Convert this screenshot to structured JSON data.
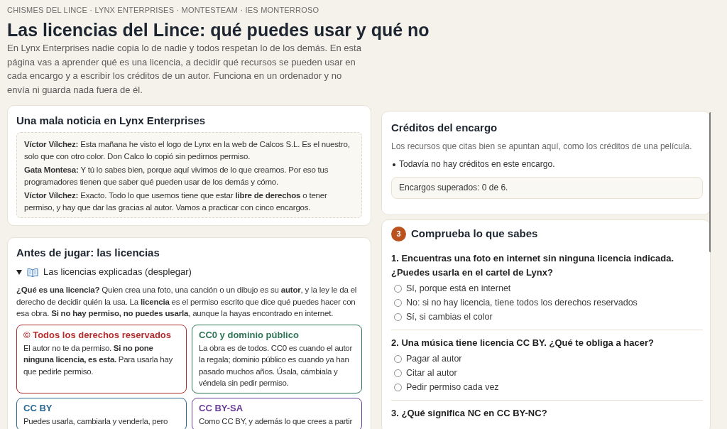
{
  "breadcrumb": "CHISMES DEL LINCE · LYNX ENTERPRISES · MONTESTEAM · IES MONTERROSO",
  "title": "Las licencias del Lince: qué puedes usar y qué no",
  "intro": "En Lynx Enterprises nadie copia lo de nadie y todos respetan lo de los demás. En esta página vas a aprender qué es una licencia, a decidir qué recursos se pueden usar en cada encargo y a escribir los créditos de un autor. Funciona en un ordenador y no envía ni guarda nada fuera de él.",
  "story": {
    "title": "Una mala noticia en Lynx Enterprises",
    "lines": [
      "**Víctor Vílchez:** Esta mañana he visto el logo de Lynx en la web de Calcos S.L. Es el nuestro, solo que con otro color. Don Calco lo copió sin pedirnos permiso.",
      "**Gata Montesa:** Y tú lo sabes bien, porque aquí vivimos de lo que creamos. Por eso tus programadores tienen que saber qué pueden usar de los demás y cómo.",
      "**Víctor Vílchez:** Exacto. Todo lo que usemos tiene que estar **libre de derechos** o tener permiso, y hay que dar las gracias al autor. Vamos a practicar con cinco encargos."
    ]
  },
  "licenses": {
    "title": "Antes de jugar: las licencias",
    "details": {
      "label": "Las licencias explicadas (desplegar)",
      "expanded": true
    },
    "explanation": "**¿Qué es una licencia?** Quien crea una foto, una canción o un dibujo es su **autor**, y la ley le da el derecho de decidir quién la usa. La **licencia** es el permiso escrito que dice qué puedes hacer con esa obra. **Si no hay permiso, no puedes usarla**, aunque la hayas encontrado en internet.",
    "cards": [
      {
        "title": "© Todos los derechos reservados",
        "color": "#b22d2d",
        "text": "El autor no te da permiso. **Si no pone ninguna licencia, es esta.** Para usarla hay que pedirle permiso."
      },
      {
        "title": "CC0 y dominio público",
        "color": "#2e7656",
        "text": "La obra es de todos. CC0 es cuando el autor la regala; dominio público es cuando ya han pasado muchos años. Úsala, cámbiala y véndela sin pedir permiso."
      },
      {
        "title": "CC BY",
        "color": "#2b6a93",
        "text": "Puedes usarla, cambiarla y venderla, pero"
      },
      {
        "title": "CC BY-SA",
        "color": "#6a3d9a",
        "text": "Como CC BY, y además lo que crees a partir"
      }
    ]
  },
  "credits": {
    "title": "Créditos del encargo",
    "subtitle": "Los recursos que citas bien se apuntan aquí, como los créditos de una película.",
    "items": [
      "Todavía no hay créditos en este encargo."
    ],
    "status": "Encargos superados: 0 de 6."
  },
  "quiz": {
    "step": "3",
    "title": "Comprueba lo que sabes",
    "questions": [
      {
        "text": "1. Encuentras una foto en internet sin ninguna licencia indicada. ¿Puedes usarla en el cartel de Lynx?",
        "options": [
          {
            "label": "Sí, porque está en internet",
            "selected": false
          },
          {
            "label": "No: si no hay licencia, tiene todos los derechos reservados",
            "selected": false
          },
          {
            "label": "Sí, si cambias el color",
            "selected": false
          }
        ]
      },
      {
        "text": "2. Una música tiene licencia CC BY. ¿Qué te obliga a hacer?",
        "options": [
          {
            "label": "Pagar al autor",
            "selected": false
          },
          {
            "label": "Citar al autor",
            "selected": false
          },
          {
            "label": "Pedir permiso cada vez",
            "selected": false
          }
        ]
      },
      {
        "text": "3. ¿Qué significa NC en CC BY-NC?"
      }
    ]
  }
}
